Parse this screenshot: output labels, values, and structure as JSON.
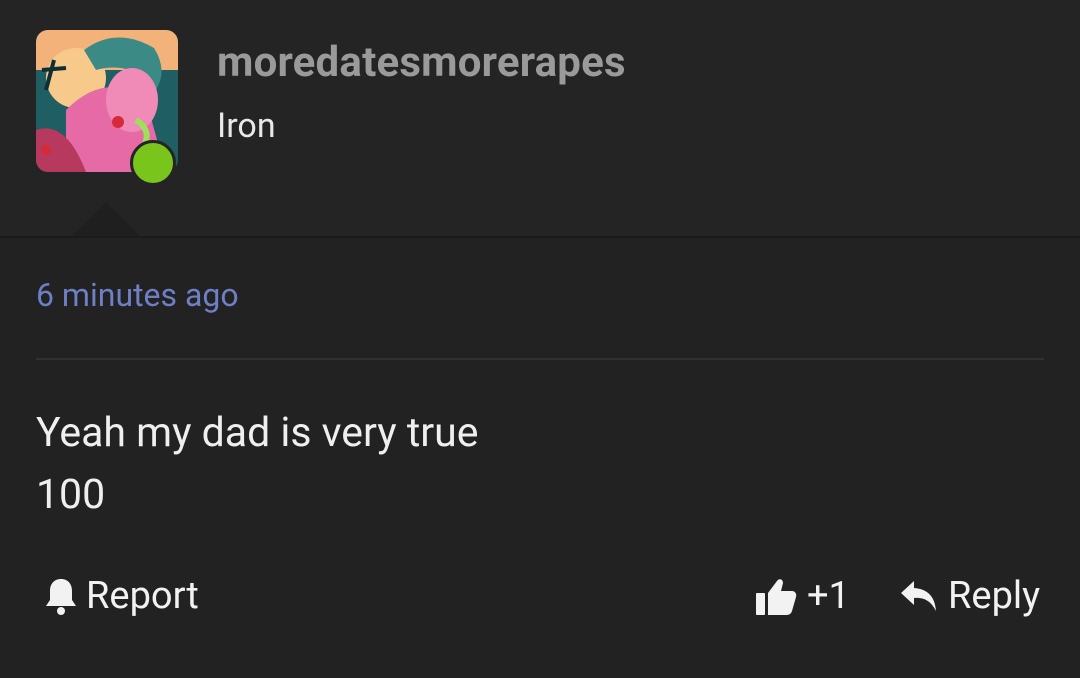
{
  "post": {
    "username": "moredatesmorerapes",
    "rank": "Iron",
    "timestamp": "6 minutes ago",
    "body_lines": [
      "Yeah my dad is very true",
      "100"
    ]
  },
  "actions": {
    "report_label": "Report",
    "like_count": "+1",
    "reply_label": "Reply"
  },
  "icons": {
    "report": "bell-icon",
    "like": "thumbs-up-icon",
    "reply": "reply-arrow-icon"
  },
  "colors": {
    "background": "#222222",
    "username": "#9a9a9a",
    "timestamp": "#6f7fc6",
    "online_status": "#7ac51b"
  }
}
